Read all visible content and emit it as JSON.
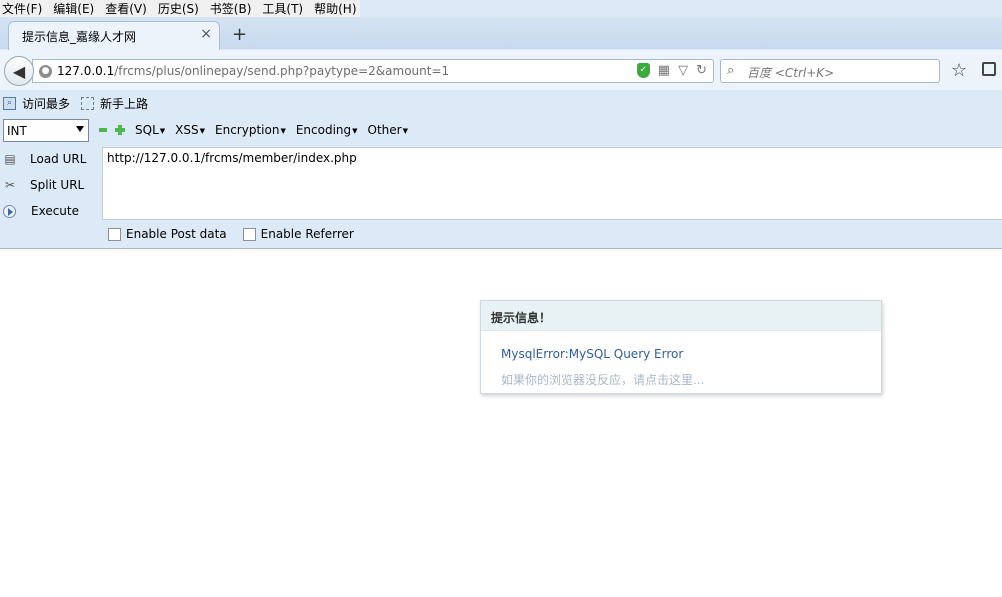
{
  "menubar": {
    "items": [
      "文件(F)",
      "编辑(E)",
      "查看(V)",
      "历史(S)",
      "书签(B)",
      "工具(T)",
      "帮助(H)"
    ]
  },
  "tabs": {
    "active_title": "提示信息_嘉缘人才网",
    "close_glyph": "×",
    "new_tab_glyph": "+"
  },
  "navbar": {
    "url_host": "127.0.0.1",
    "url_path": "/frcms/plus/onlinepay/send.php?paytype=2&amount=1",
    "search_placeholder": "百度 <Ctrl+K>"
  },
  "bookmarks": {
    "items": [
      "访问最多",
      "新手上路"
    ]
  },
  "hackbar": {
    "type_select": "INT",
    "menus": [
      "SQL",
      "XSS",
      "Encryption",
      "Encoding",
      "Other"
    ],
    "load_url": "Load URL",
    "split_url": "Split URL",
    "execute": "Execute",
    "url_value": "http://127.0.0.1/frcms/member/index.php",
    "enable_post": "Enable Post data",
    "enable_referrer": "Enable Referrer"
  },
  "message": {
    "title": "提示信息！",
    "error": "MysqlError:MySQL Query Error",
    "hint": "如果你的浏览器没反应，请点击这里..."
  },
  "colors": {
    "chrome_bg": "#dce9f6",
    "link_blue": "#2f5ea0",
    "hint_gray": "#a8b8c7"
  }
}
